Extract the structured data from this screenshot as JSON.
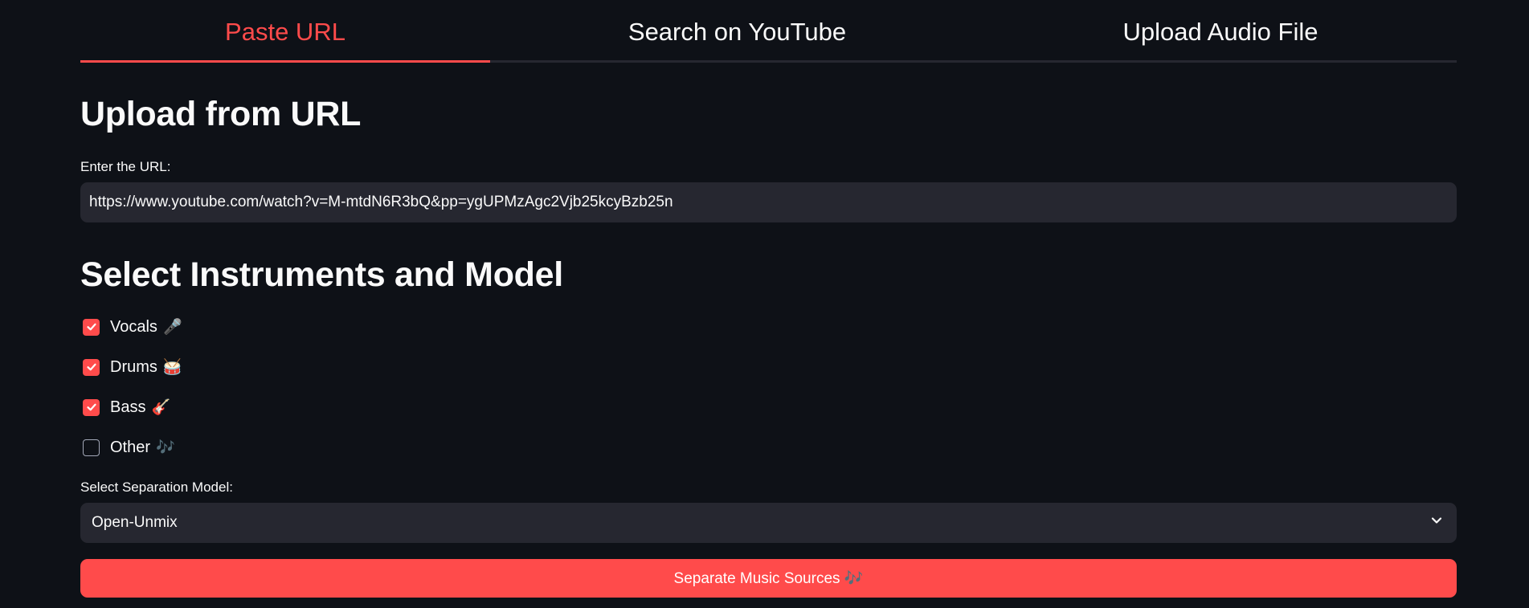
{
  "tabs": [
    {
      "label": "Paste URL",
      "active": true
    },
    {
      "label": "Search on YouTube",
      "active": false
    },
    {
      "label": "Upload Audio File",
      "active": false
    }
  ],
  "upload_section": {
    "title": "Upload from URL",
    "url_label": "Enter the URL:",
    "url_value": "https://www.youtube.com/watch?v=M-mtdN6R3bQ&pp=ygUPMzAgc2Vjb25kcyBzb25n"
  },
  "instruments_section": {
    "title": "Select Instruments and Model",
    "instruments": [
      {
        "label": "Vocals",
        "emoji": "🎤",
        "checked": true
      },
      {
        "label": "Drums",
        "emoji": "🥁",
        "checked": true
      },
      {
        "label": "Bass",
        "emoji": "🎸",
        "checked": true
      },
      {
        "label": "Other",
        "emoji": "🎶",
        "checked": false
      }
    ],
    "model_label": "Select Separation Model:",
    "model_value": "Open-Unmix"
  },
  "action": {
    "label": "Separate Music Sources 🎶"
  },
  "colors": {
    "background": "#0e1117",
    "accent": "#ff4b4b",
    "input_bg": "#262730",
    "text": "#fafafa"
  }
}
